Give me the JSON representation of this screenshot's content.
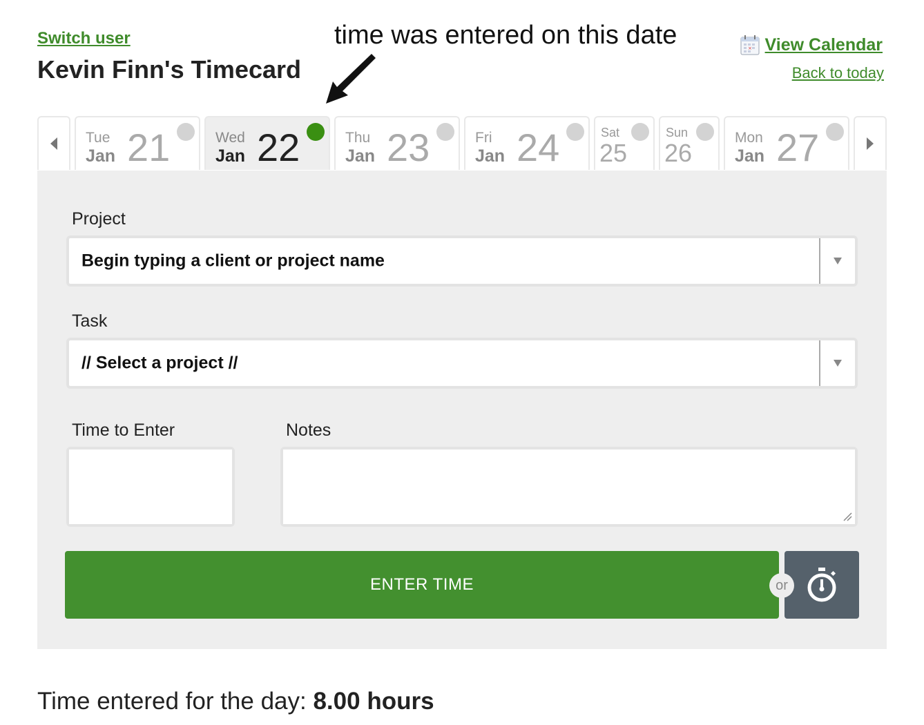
{
  "header": {
    "switch_user": "Switch user",
    "title": "Kevin Finn's Timecard",
    "view_calendar": "View Calendar",
    "back_to_today": "Back to today",
    "calendar_icon": "calendar-icon"
  },
  "annotation": {
    "text": "time was entered on this date",
    "arrow_icon": "arrow-icon"
  },
  "day_strip": {
    "prev_icon": "triangle-left-icon",
    "next_icon": "triangle-right-icon",
    "days": [
      {
        "dow": "Tue",
        "month": "Jan",
        "day": "21",
        "has_time": false,
        "selected": false
      },
      {
        "dow": "Wed",
        "month": "Jan",
        "day": "22",
        "has_time": true,
        "selected": true
      },
      {
        "dow": "Thu",
        "month": "Jan",
        "day": "23",
        "has_time": false,
        "selected": false
      },
      {
        "dow": "Fri",
        "month": "Jan",
        "day": "24",
        "has_time": false,
        "selected": false
      },
      {
        "dow": "Sat",
        "month": "",
        "day": "25",
        "has_time": false,
        "selected": false
      },
      {
        "dow": "Sun",
        "month": "",
        "day": "26",
        "has_time": false,
        "selected": false
      },
      {
        "dow": "Mon",
        "month": "Jan",
        "day": "27",
        "has_time": false,
        "selected": false
      }
    ],
    "status_colors": {
      "entered": "#3a8f12",
      "empty": "#d3d3d3"
    }
  },
  "form": {
    "project_label": "Project",
    "project_placeholder": "Begin typing a client or project name",
    "task_label": "Task",
    "task_value": "// Select a project //",
    "time_label": "Time to Enter",
    "time_value": "",
    "notes_label": "Notes",
    "notes_value": "",
    "enter_button": "ENTER TIME",
    "or_label": "or",
    "timer_icon": "stopwatch-icon",
    "accent_color": "#43902f",
    "timer_color": "#55616b"
  },
  "summary": {
    "prefix": "Time entered for the day: ",
    "hours": "8.00 hours"
  }
}
